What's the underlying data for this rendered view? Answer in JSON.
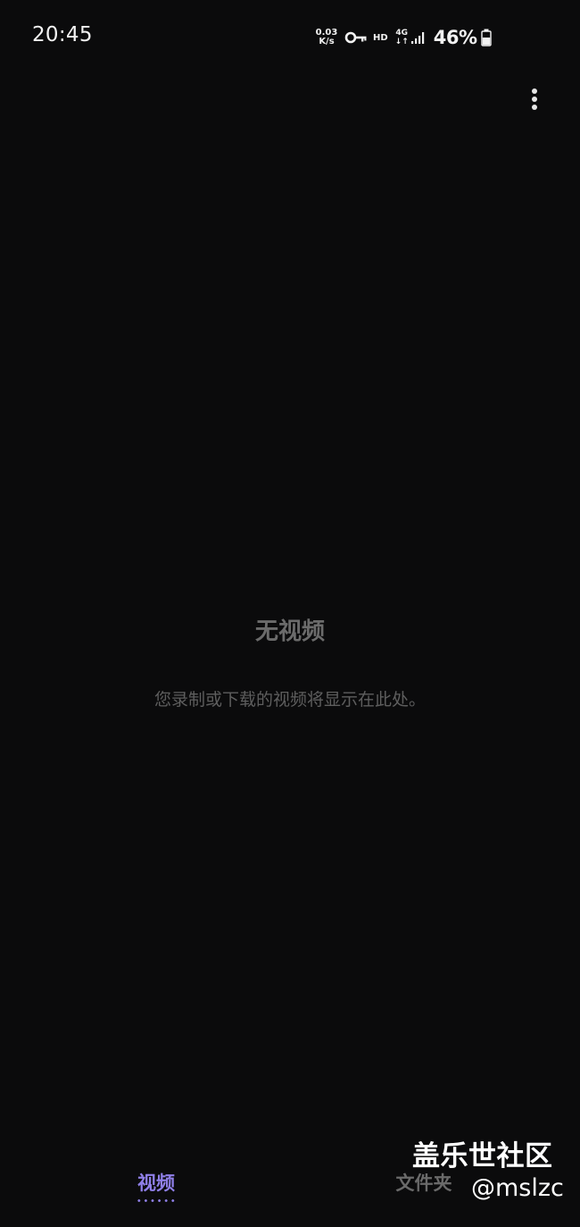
{
  "status_bar": {
    "time": "20:45",
    "net_speed_value": "0.03",
    "net_speed_unit": "K/s",
    "hd_label": "HD",
    "network_type": "4G",
    "network_arrows": "↓↑",
    "battery_percent": "46%",
    "icons": [
      "vpn-key-icon",
      "signal-icon",
      "battery-icon"
    ]
  },
  "app_bar": {
    "more_icon": "more-vertical-icon"
  },
  "empty_state": {
    "title": "无视频",
    "description": "您录制或下载的视频将显示在此处。"
  },
  "tabs": [
    {
      "label": "视频",
      "selected": true
    },
    {
      "label": "文件夹",
      "selected": false
    }
  ],
  "watermark": {
    "title": "盖乐世社区",
    "handle": "@mslzc"
  },
  "colors": {
    "background": "#0b0b0c",
    "accent": "#8f7fe8",
    "muted_text": "#6b6b6b"
  }
}
